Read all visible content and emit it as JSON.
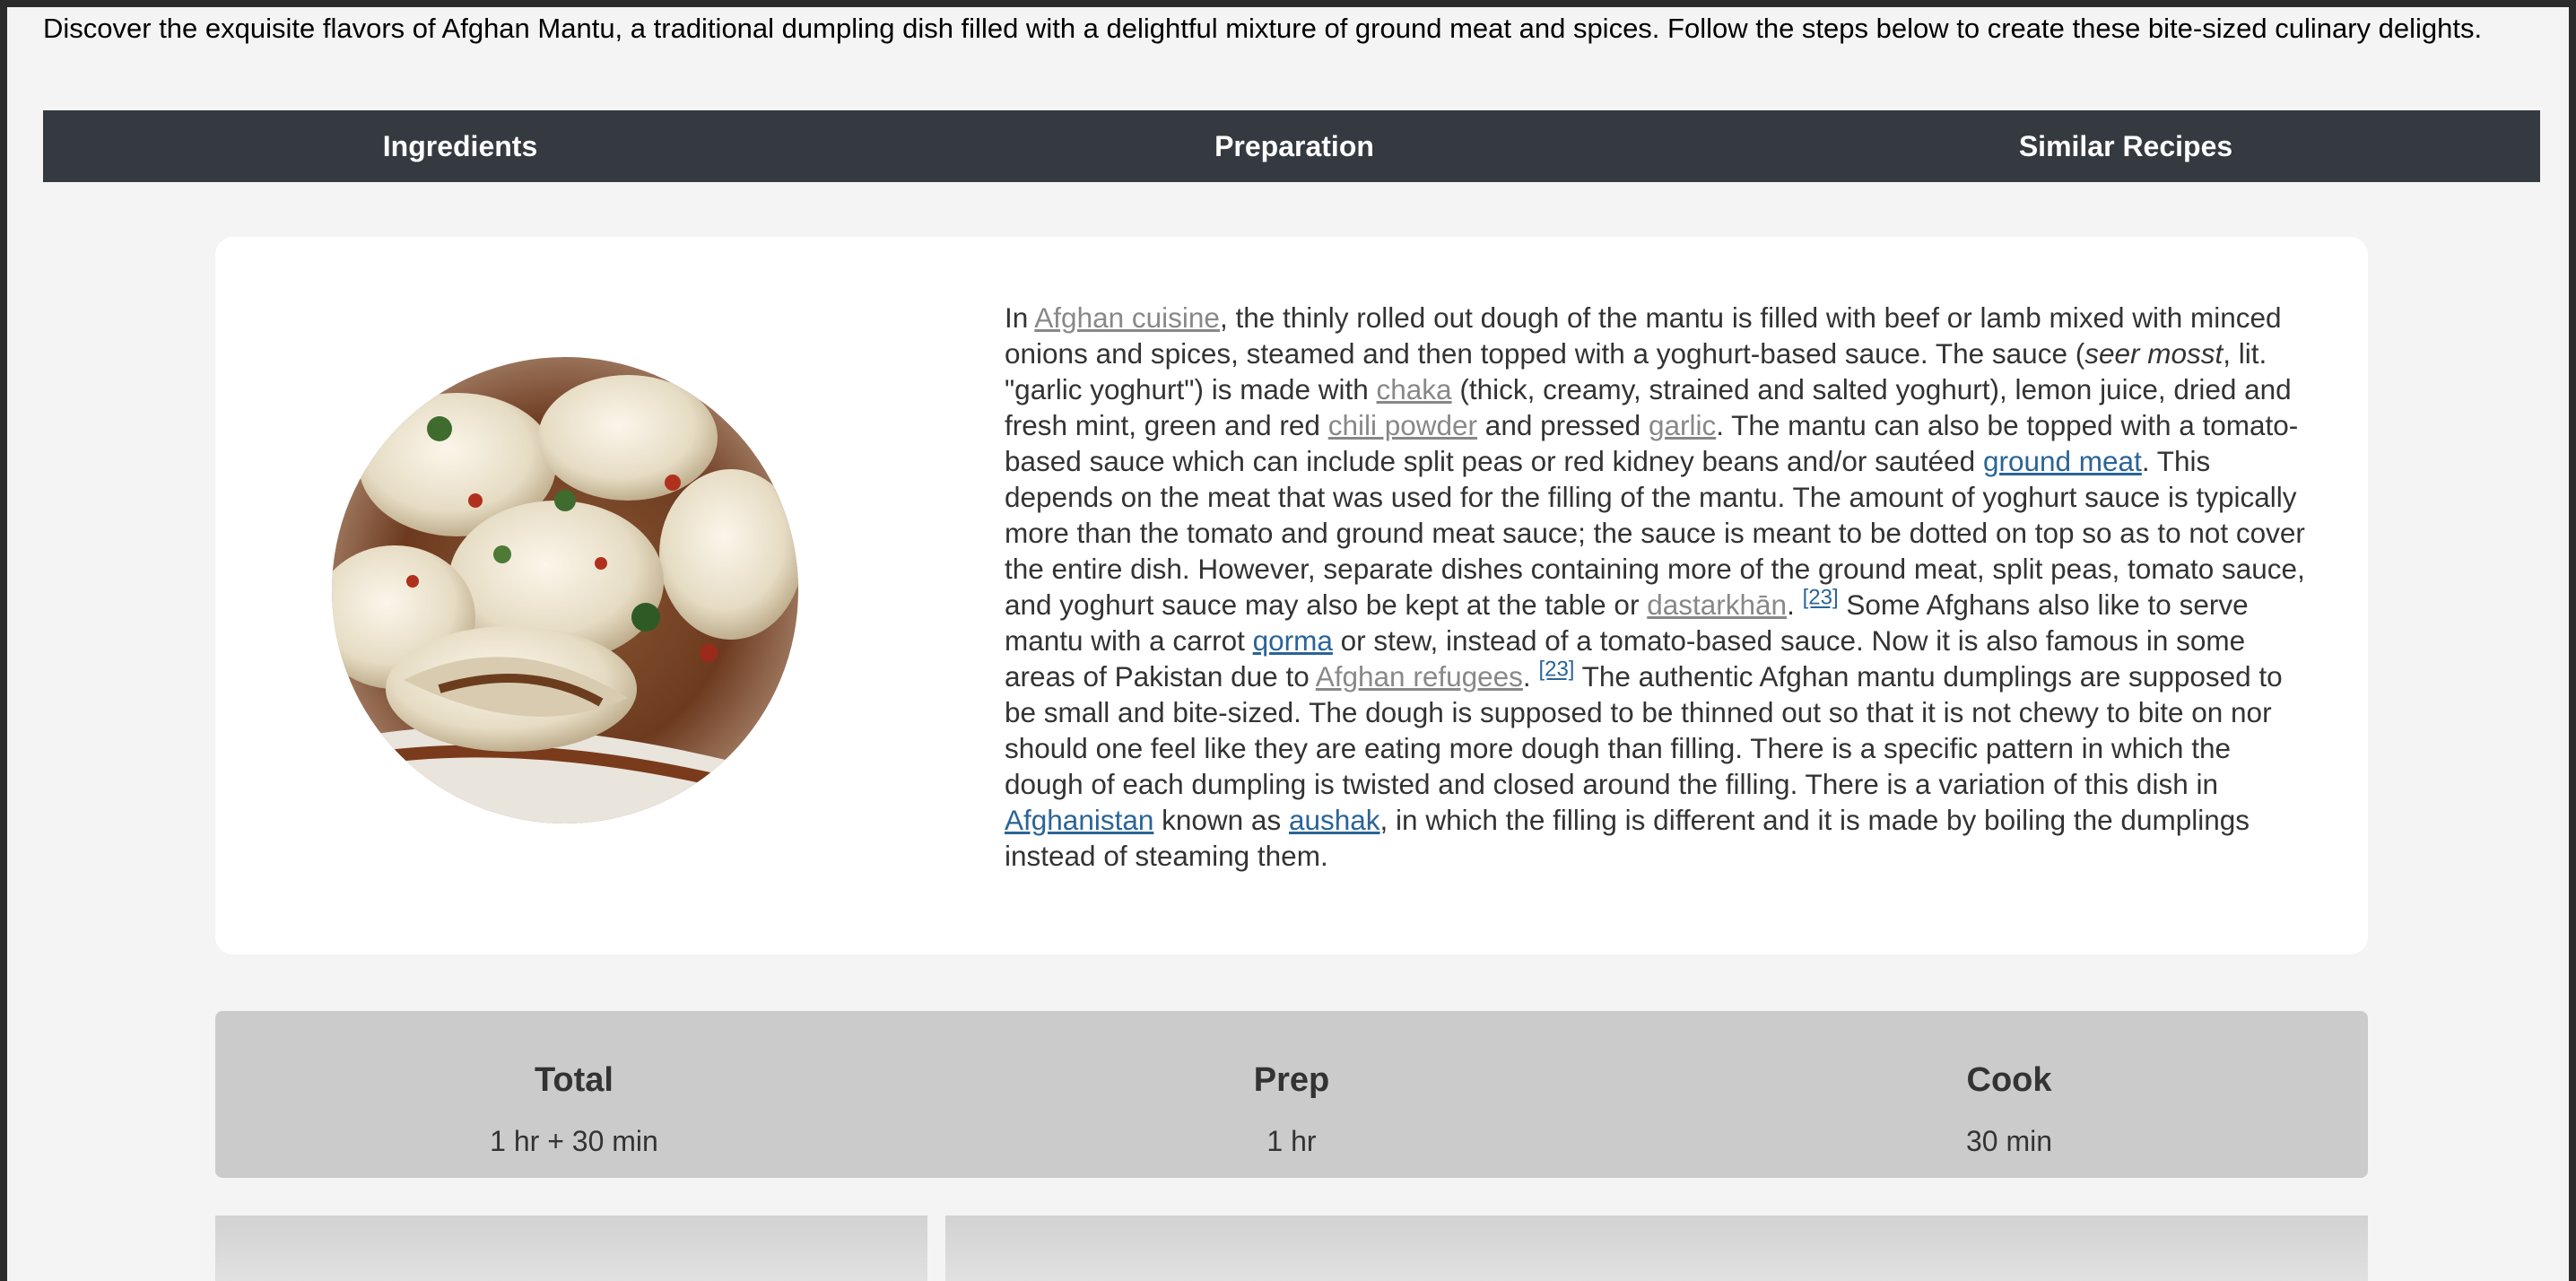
{
  "intro": "Discover the exquisite flavors of Afghan Mantu, a traditional dumpling dish filled with a delightful mixture of ground meat and spices. Follow the steps below to create these bite-sized culinary delights.",
  "nav": {
    "ingredients": "Ingredients",
    "preparation": "Preparation",
    "similar": "Similar Recipes"
  },
  "description": {
    "t1": "In ",
    "link_afghan_cuisine": "Afghan cuisine",
    "t2": ", the thinly rolled out dough of the mantu is filled with beef or lamb mixed with minced onions and spices, steamed and then topped with a yoghurt-based sauce. The sauce (",
    "em_seer_mosst": "seer mosst",
    "t3": ", lit. \"garlic yoghurt\") is made with ",
    "link_chaka": "chaka",
    "t4": " (thick, creamy, strained and salted yoghurt), lemon juice, dried and fresh mint, green and red ",
    "link_chili_powder": "chili powder",
    "t5": " and pressed ",
    "link_garlic": "garlic",
    "t6": ". The mantu can also be topped with a tomato-based sauce which can include split peas or red kidney beans and/or sautéed ",
    "link_ground_meat": "ground meat",
    "t7": ". This depends on the meat that was used for the filling of the mantu. The amount of yoghurt sauce is typically more than the tomato and ground meat sauce; the sauce is meant to be dotted on top so as to not cover the entire dish. However, separate dishes containing more of the ground meat, split peas, tomato sauce, and yoghurt sauce may also be kept at the table or ",
    "link_dastarkhan": "dastarkhān",
    "t8": ". ",
    "ref_1": "[23]",
    "t9": " Some Afghans also like to serve mantu with a carrot ",
    "link_qorma": "qorma",
    "t10": " or stew, instead of a tomato-based sauce. Now it is also famous in some areas of Pakistan due to ",
    "link_afghan_refugees": "Afghan refugees",
    "t11": ". ",
    "ref_2": "[23]",
    "t12": " The authentic Afghan mantu dumplings are supposed to be small and bite-sized. The dough is supposed to be thinned out so that it is not chewy to bite on nor should one feel like they are eating more dough than filling. There is a specific pattern in which the dough of each dumpling is twisted and closed around the filling. There is a variation of this dish in ",
    "link_afghanistan": "Afghanistan",
    "t13": " known as ",
    "link_aushak": "aushak",
    "t14": ", in which the filling is different and it is made by boiling the dumplings instead of steaming them."
  },
  "times": {
    "total_label": "Total",
    "total_value": "1 hr + 30 min",
    "prep_label": "Prep",
    "prep_value": "1 hr",
    "cook_label": "Cook",
    "cook_value": "30 min"
  },
  "colors": {
    "nav_bg": "#343a40",
    "link_gray": "#888888",
    "link_blue": "#2a6496",
    "times_bg": "#cbcbcb"
  }
}
